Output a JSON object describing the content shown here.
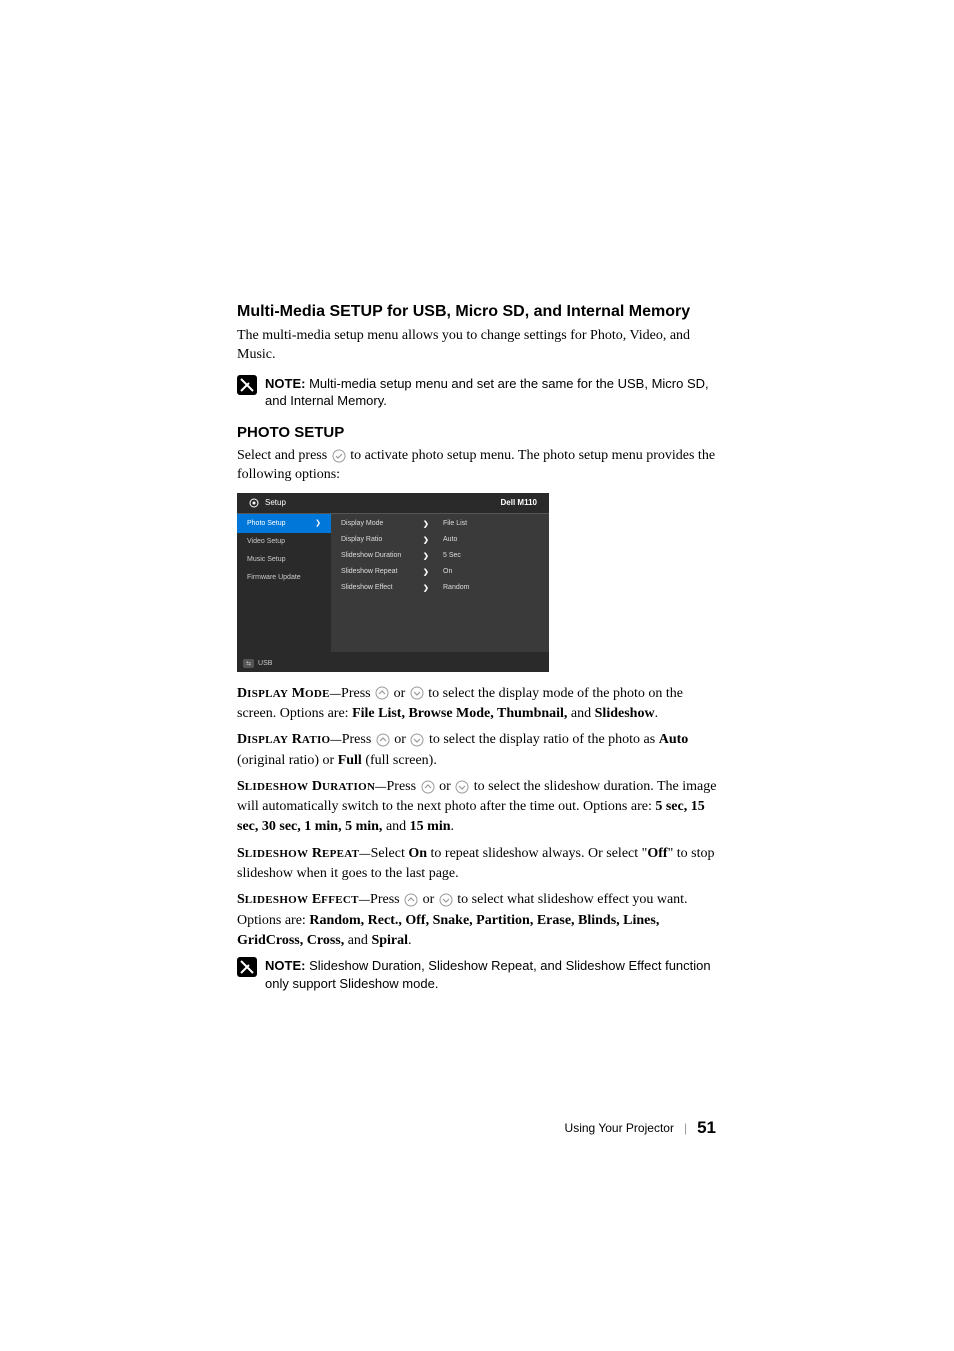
{
  "headings": {
    "setup_heading": "Multi-Media SETUP for USB, Micro SD, and Internal Memory",
    "photo_setup": "PHOTO SETUP"
  },
  "intro": "The multi-media setup menu allows you to change settings for Photo, Video, and Music.",
  "note1": {
    "label": "NOTE:",
    "text": " Multi-media setup menu and set are the same for the USB, Micro SD, and Internal Memory."
  },
  "photo_intro_1": "Select and press ",
  "photo_intro_2": " to activate photo setup menu. The photo setup menu provides the following options:",
  "osd": {
    "title": "Setup",
    "brand": "Dell M110",
    "sidebar": [
      "Photo Setup",
      "Video Setup",
      "Music Setup",
      "Firmware Update"
    ],
    "rows": [
      {
        "label": "Display Mode",
        "val": "File List"
      },
      {
        "label": "Display Ratio",
        "val": "Auto"
      },
      {
        "label": "Slideshow Duration",
        "val": "5 Sec"
      },
      {
        "label": "Slideshow Repeat",
        "val": "On"
      },
      {
        "label": "Slideshow Effect",
        "val": "Random"
      }
    ],
    "footer": "USB"
  },
  "descriptions": {
    "display_mode": {
      "label_big": "D",
      "label_rest": "ISPLAY",
      "label_big2": " M",
      "label_rest2": "ODE—",
      "t1": "Press ",
      "t2": " or ",
      "t3": " to select the display mode of the photo on the screen. Options are: ",
      "opts": "File List, Browse Mode, Thumbnail, ",
      "and": "and ",
      "last": "Slideshow",
      "period": "."
    },
    "display_ratio": {
      "label_big": "D",
      "label_rest": "ISPLAY",
      "label_big2": " R",
      "label_rest2": "ATIO—",
      "t1": "Press ",
      "t2": " or ",
      "t3": " to select the display ratio of the photo as ",
      "auto": "Auto",
      "t4": " (original ratio) or ",
      "full": "Full",
      "t5": " (full screen)."
    },
    "slideshow_duration": {
      "label_big": "S",
      "label_rest": "LIDESHOW",
      "label_big2": " D",
      "label_rest2": "URATION—",
      "t1": "Press ",
      "t2": " or ",
      "t3": " to select the slideshow duration. The image will automatically switch to the next photo after the time out. Options are: ",
      "opts": "5 sec, 15 sec, 30 sec, 1 min, 5 min, ",
      "and": "and ",
      "last": "15 min",
      "period": "."
    },
    "slideshow_repeat": {
      "label_big": "S",
      "label_rest": "LIDESHOW",
      "label_big2": " R",
      "label_rest2": "EPEAT—",
      "t1": "Select ",
      "on": "On",
      "t2": " to repeat slideshow always. Or select \"",
      "off": "Off",
      "t3": "\" to stop slideshow when it goes to the last page."
    },
    "slideshow_effect": {
      "label_big": "S",
      "label_rest": "LIDESHOW",
      "label_big2": " E",
      "label_rest2": "FFECT—",
      "t1": "Press ",
      "t2": " or ",
      "t3": " to select what slideshow effect you want. Options are: ",
      "opts": "Random, Rect., Off, Snake, Partition, Erase, Blinds, Lines, GridCross, Cross, ",
      "and": "and ",
      "last": "Spiral",
      "period": "."
    }
  },
  "note2": {
    "label": "NOTE:",
    "text": " Slideshow Duration, Slideshow Repeat, and Slideshow Effect function only support Slideshow mode."
  },
  "footer": {
    "section": "Using Your Projector",
    "page": "51"
  }
}
